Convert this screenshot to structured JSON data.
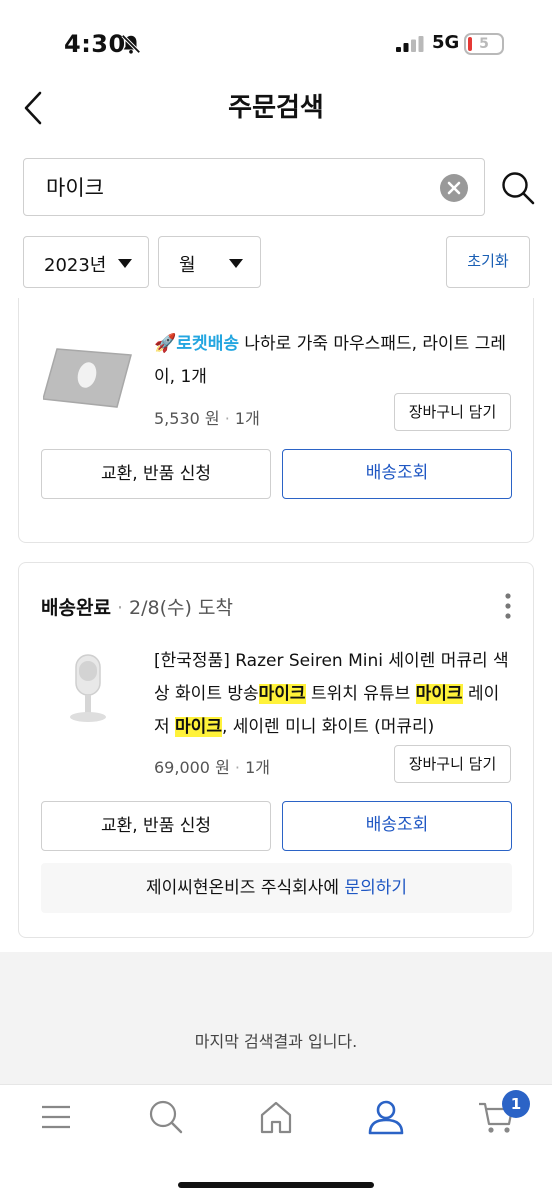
{
  "status_bar": {
    "time": "4:30",
    "network": "5G",
    "battery": "5"
  },
  "header": {
    "title": "주문검색"
  },
  "search": {
    "value": "마이크"
  },
  "filters": {
    "year": "2023년",
    "month": "월",
    "reset_label": "초기화"
  },
  "orders": [
    {
      "rocket_label": "로켓배송",
      "product_name": " 나하로 가죽 마우스패드, 라이트 그레이, 1개",
      "price": "5,530 원",
      "quantity": "1개",
      "cart_button": "장바구니 담기",
      "return_button": "교환, 반품 신청",
      "track_button": "배송조회"
    },
    {
      "status": "배송완료",
      "date": "2/8(수) 도착",
      "product_parts": [
        "[한국정품] Razer Seiren Mini 세이렌 머큐리 색상 화이트 방송",
        "마이크",
        " 트위치 유튜브 ",
        "마이크",
        " 레이저 ",
        "마이크",
        ", 세이렌 미니 화이트 (머큐리)"
      ],
      "price": "69,000 원",
      "quantity": "1개",
      "cart_button": "장바구니 담기",
      "return_button": "교환, 반품 신청",
      "track_button": "배송조회",
      "inquiry_text": "제이씨현온비즈 주식회사에 ",
      "inquiry_link": "문의하기"
    }
  ],
  "end_message": "마지막 검색결과 입니다.",
  "tab_bar": {
    "items": [
      "menu-icon",
      "search-icon",
      "home-icon",
      "user-icon",
      "cart-icon"
    ],
    "cart_badge": "1"
  },
  "colors": {
    "accent": "#2b63c6",
    "highlight": "#fff23a",
    "rocket": "#23a6e0"
  }
}
